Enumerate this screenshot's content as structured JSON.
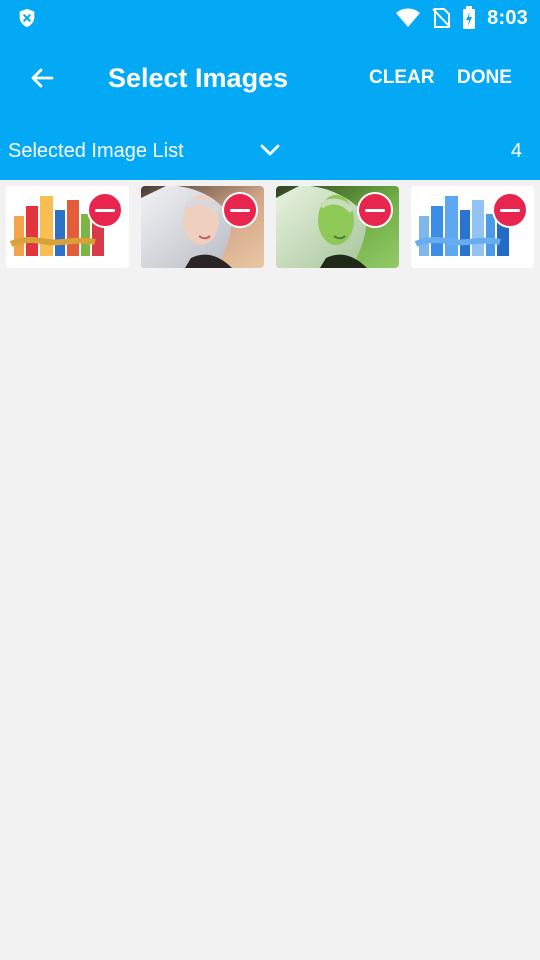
{
  "status_bar": {
    "time": "8:03",
    "left_icon": "shield-x-icon",
    "right_icons": [
      "wifi-icon",
      "no-sim-icon",
      "battery-charging-icon"
    ]
  },
  "app_bar": {
    "title": "Select Images",
    "back_icon": "arrow-left-icon",
    "clear_label": "CLEAR",
    "done_label": "DONE"
  },
  "list_header": {
    "title": "Selected Image List",
    "dropdown_icon": "chevron-down-icon",
    "count": "4"
  },
  "selected_images": [
    {
      "kind": "text-collage-red",
      "remove_icon": "minus-circle-icon"
    },
    {
      "kind": "character-portrait-light",
      "remove_icon": "minus-circle-icon"
    },
    {
      "kind": "character-portrait-green",
      "remove_icon": "minus-circle-icon"
    },
    {
      "kind": "text-collage-blue",
      "remove_icon": "minus-circle-icon"
    }
  ],
  "colors": {
    "primary": "#03a9f4",
    "remove": "#e8254f",
    "background": "#f2f2f2"
  }
}
